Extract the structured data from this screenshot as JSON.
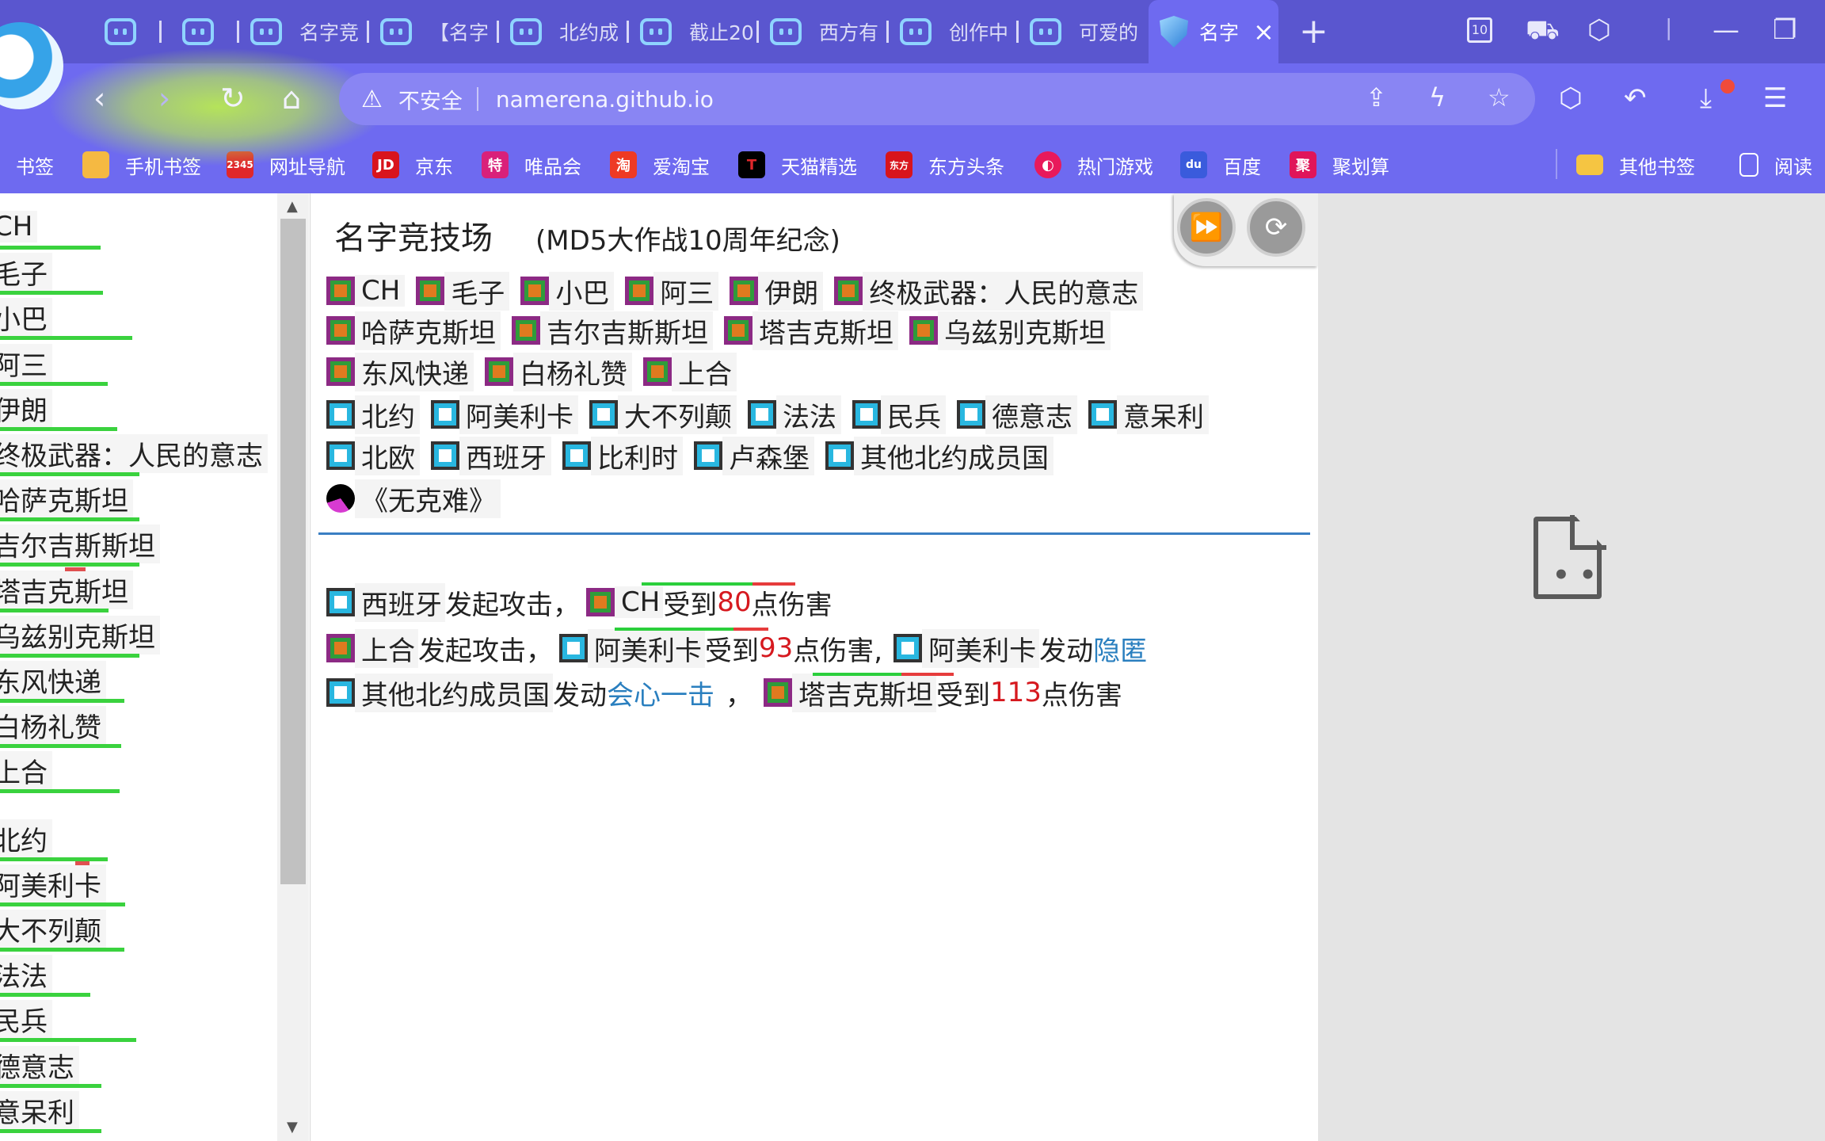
{
  "browser": {
    "tabs": [
      {
        "label": ""
      },
      {
        "label": ""
      },
      {
        "label": "名字竞"
      },
      {
        "label": "【名字"
      },
      {
        "label": "北约成"
      },
      {
        "label": "截止20"
      },
      {
        "label": "西方有"
      },
      {
        "label": "创作中"
      },
      {
        "label": "可爱的"
      }
    ],
    "active_tab": {
      "label": "名字",
      "close": "×"
    },
    "tab_count_badge": "10",
    "address": {
      "security_label": "不安全",
      "url": "namerena.github.io"
    },
    "bookmarks": [
      {
        "label": "书签",
        "icon": "bookmark-icon"
      },
      {
        "label": "手机书签",
        "icon": "phone-bookmark-icon",
        "color": "#f5b942"
      },
      {
        "label": "网址导航",
        "icon": "web-nav-icon",
        "color": "#e0272b",
        "glyph": "2345"
      },
      {
        "label": "京东",
        "icon": "jd-icon",
        "color": "#d8141c",
        "glyph": "JD"
      },
      {
        "label": "唯品会",
        "icon": "vip-icon",
        "color": "#d9207a",
        "glyph": "特"
      },
      {
        "label": "爱淘宝",
        "icon": "taobao-icon",
        "color": "#ee3a24",
        "glyph": "淘"
      },
      {
        "label": "天猫精选",
        "icon": "tmall-icon",
        "color": "#000000",
        "glyph": "T"
      },
      {
        "label": "东方头条",
        "icon": "dftt-icon",
        "color": "#d8141c",
        "glyph": "东方"
      },
      {
        "label": "热门游戏",
        "icon": "game-icon",
        "color": "#e8195b",
        "glyph": "◐"
      },
      {
        "label": "百度",
        "icon": "baidu-icon",
        "color": "#3a5bdc",
        "glyph": "du"
      },
      {
        "label": "聚划算",
        "icon": "juhuasuan-icon",
        "color": "#e0155a",
        "glyph": "聚"
      },
      {
        "label": "其他书签",
        "icon": "folder-icon",
        "color": "#f5c542"
      },
      {
        "label": "阅读",
        "icon": "reading-icon"
      }
    ]
  },
  "left_list": [
    {
      "name": "CH",
      "hp": 0.72,
      "team": "a"
    },
    {
      "name": "毛子",
      "hp": 0.74,
      "team": "a"
    },
    {
      "name": "小巴",
      "hp": 0.95,
      "team": "a"
    },
    {
      "name": "阿三",
      "hp": 0.77,
      "team": "a"
    },
    {
      "name": "伊朗",
      "hp": 0.84,
      "team": "a"
    },
    {
      "name": "终极武器：人民的意志",
      "hp": 1.0,
      "team": "a"
    },
    {
      "name": "哈萨克斯坦",
      "hp": 1.0,
      "team": "a"
    },
    {
      "name": "吉尔吉斯斯坦",
      "hp": 1.0,
      "team": "a"
    },
    {
      "name": "塔吉克斯坦",
      "hp": 0.78,
      "team": "a",
      "lost": 0.15
    },
    {
      "name": "乌兹别克斯坦",
      "hp": 1.0,
      "team": "a"
    },
    {
      "name": "东风快递",
      "hp": 0.89,
      "team": "a"
    },
    {
      "name": "白杨礼赞",
      "hp": 0.87,
      "team": "a"
    },
    {
      "name": "上合",
      "hp": 0.86,
      "team": "a"
    },
    {
      "name": "北约",
      "hp": 0.77,
      "team": "b"
    },
    {
      "name": "阿美利卡",
      "hp": 0.9,
      "team": "b",
      "lost": 0.1
    },
    {
      "name": "大不列颠",
      "hp": 0.89,
      "team": "b"
    },
    {
      "name": "法法",
      "hp": 0.65,
      "team": "b"
    },
    {
      "name": "民兵",
      "hp": 0.98,
      "team": "b"
    },
    {
      "name": "德意志",
      "hp": 0.73,
      "team": "b"
    },
    {
      "name": "意呆利",
      "hp": 0.73,
      "team": "b"
    }
  ],
  "main": {
    "title": "名字竞技场",
    "subtitle": "(MD5大作战10周年纪念)",
    "controls": {
      "fast_forward": "⏩",
      "refresh": "⟳"
    },
    "players_row1": [
      "CH",
      "毛子",
      "小巴",
      "阿三",
      "伊朗",
      "终极武器：人民的意志"
    ],
    "players_row2": [
      "哈萨克斯坦",
      "吉尔吉斯斯坦",
      "塔吉克斯坦",
      "乌兹别克斯坦"
    ],
    "players_row3": [
      "东风快递",
      "白杨礼赞",
      "上合"
    ],
    "players_row4": [
      "北约",
      "阿美利卡",
      "大不列颠",
      "法法",
      "民兵",
      "德意志",
      "意呆利"
    ],
    "players_row5": [
      "北欧",
      "西班牙",
      "比利时",
      "卢森堡",
      "其他北约成员国"
    ],
    "players_row6": [
      "《无克难》"
    ],
    "log": [
      {
        "actor": "西班牙",
        "action": " 发起攻击，",
        "target": "CH",
        "verb": " 受到",
        "damage": "80",
        "suffix": "点伤害",
        "extra_target": "",
        "extra_action": "",
        "skill": ""
      },
      {
        "actor": "上合",
        "action": " 发起攻击，",
        "target": "阿美利卡",
        "verb": " 受到",
        "damage": "93",
        "suffix": "点伤害,",
        "extra_target": "阿美利卡",
        "extra_action": " 发动",
        "skill": "隐匿"
      },
      {
        "actor": "其他北约成员国",
        "action": " 发动",
        "skill": "会心一击",
        "comma": "，",
        "target": "塔吉克斯坦",
        "verb": " 受到",
        "damage": "113",
        "suffix": "点伤害"
      }
    ]
  }
}
